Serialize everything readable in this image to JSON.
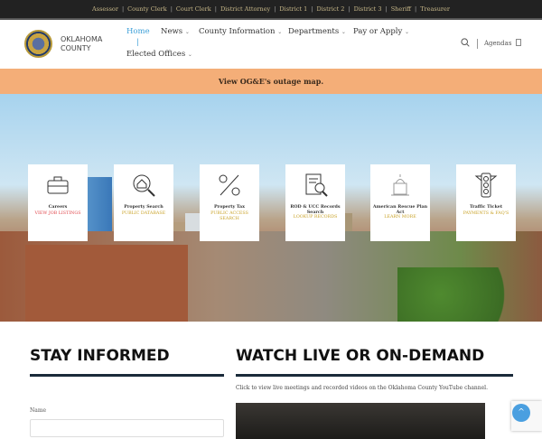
{
  "topbar": [
    "Assessor",
    "County Clerk",
    "Court Clerk",
    "District Attorney",
    "District 1",
    "District 2",
    "District 3",
    "Sheriff",
    "Treasurer"
  ],
  "logo": {
    "line1": "OKLAHOMA",
    "line2": "COUNTY"
  },
  "nav": {
    "home": "Home",
    "sep": "|",
    "news": "News",
    "county_info": "County Information",
    "departments": "Departments",
    "pay": "Pay or Apply",
    "elected": "Elected Offices",
    "caret": "⌄"
  },
  "agendas": "Agendas",
  "alert": "View OG&E's outage map.",
  "cards": [
    {
      "title": "Careers",
      "link": "VIEW JOB LISTINGS",
      "color": "#e0474c",
      "icon": "briefcase-icon"
    },
    {
      "title": "Property Search",
      "link": "PUBLIC DATABASE",
      "color": "#c9a227",
      "icon": "house-search-icon"
    },
    {
      "title": "Property Tax",
      "link": "PUBLIC ACCESS SEARCH",
      "color": "#c9a227",
      "icon": "percent-icon"
    },
    {
      "title": "ROD & UCC Records Search",
      "link": "LOOKUP RECORDS",
      "color": "#c9a227",
      "icon": "document-search-icon"
    },
    {
      "title": "American Rescue Plan Act",
      "link": "LEARN MORE",
      "color": "#c9a227",
      "icon": "capitol-icon"
    },
    {
      "title": "Traffic Ticket",
      "link": "PAYMENTS & FAQ'S",
      "color": "#c9a227",
      "icon": "traffic-light-icon"
    }
  ],
  "stay": {
    "heading": "STAY INFORMED",
    "name_label": "Name"
  },
  "watch": {
    "heading": "WATCH LIVE OR ON-DEMAND",
    "desc": "Click to view live meetings and recorded videos on the Oklahoma County YouTube channel."
  }
}
